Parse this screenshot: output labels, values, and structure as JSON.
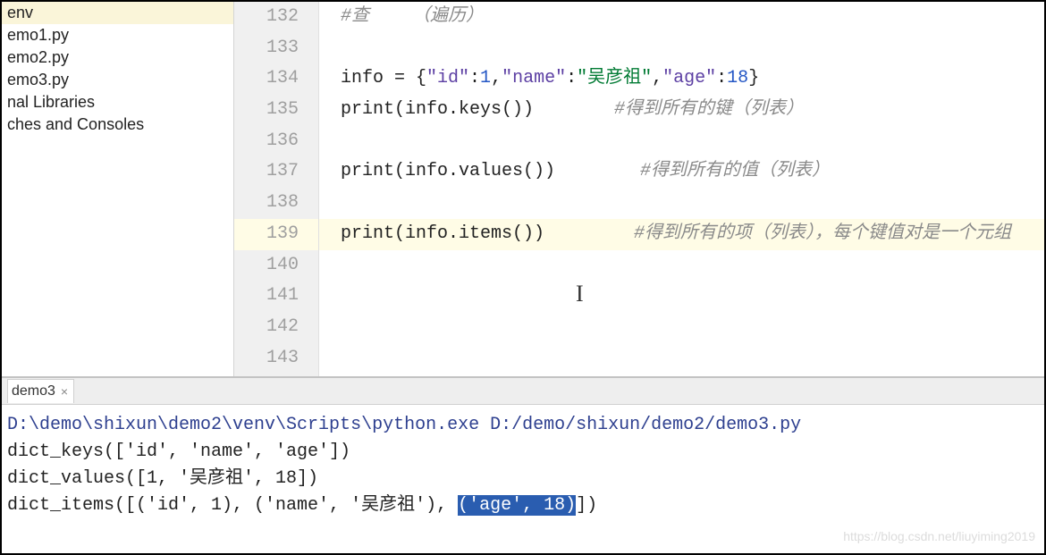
{
  "sidebar": {
    "items": [
      {
        "label": "env",
        "selected": true
      },
      {
        "label": "emo1.py",
        "selected": false
      },
      {
        "label": "emo2.py",
        "selected": false
      },
      {
        "label": "emo3.py",
        "selected": false
      },
      {
        "label": "nal Libraries",
        "selected": false
      },
      {
        "label": "ches and Consoles",
        "selected": false
      }
    ]
  },
  "editor": {
    "line_start": 132,
    "line_end": 143,
    "highlighted_line": 139,
    "lines": {
      "132": {
        "comment_prefix": "#查    （遍历）"
      },
      "134": {
        "prefix": "info = {",
        "k1": "\"id\"",
        "c1": ":",
        "v1": "1",
        "s1": ",",
        "k2": "\"name\"",
        "c2": ":",
        "v2": "\"吴彦祖\"",
        "s2": ",",
        "k3": "\"age\"",
        "c3": ":",
        "v3": "18",
        "suffix": "}"
      },
      "135": {
        "code": "print(info.keys())",
        "comment": "#得到所有的键（列表）"
      },
      "137": {
        "code": "print(info.values())",
        "comment": "#得到所有的值（列表）"
      },
      "139": {
        "code": "print(info.items())",
        "comment": "#得到所有的项（列表），每个键值对是一个元组"
      }
    }
  },
  "run": {
    "tab_label": "demo3",
    "cmd_path": "D:\\demo\\shixun\\demo2\\venv\\Scripts\\python.exe D:/demo/shixun/demo2/demo3.py",
    "out1": "dict_keys(['id', 'name', 'age'])",
    "out2": "dict_values([1, '吴彦祖', 18])",
    "out3_pre": "dict_items([('id', 1), ('name', '吴彦祖'), ",
    "out3_sel": "('age', 18)",
    "out3_post": "])"
  },
  "watermark": "https://blog.csdn.net/liuyiming2019"
}
